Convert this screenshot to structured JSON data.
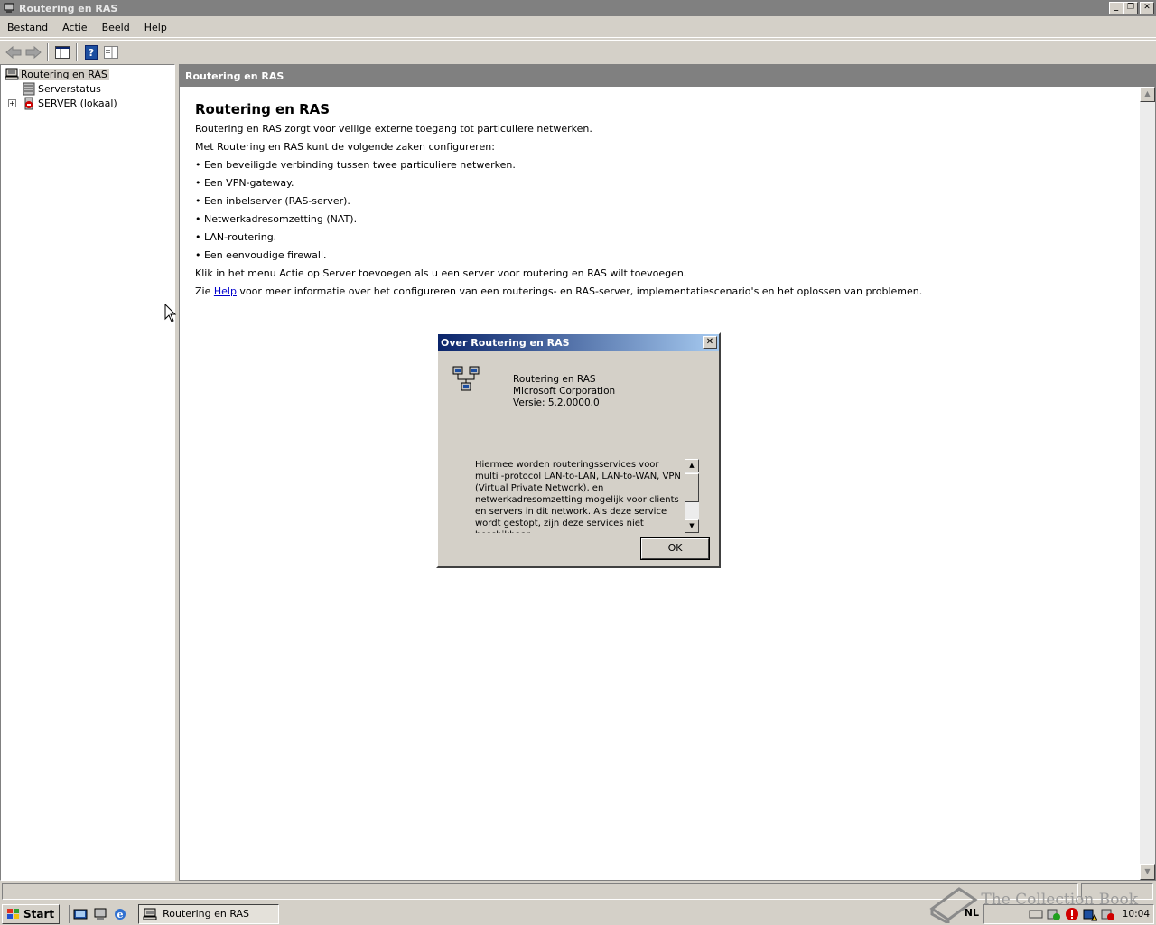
{
  "window": {
    "title": "Routering en RAS",
    "buttons": {
      "minimize": "_",
      "restore": "❐",
      "close": "✕"
    }
  },
  "menu": [
    "Bestand",
    "Actie",
    "Beeld",
    "Help"
  ],
  "tree": {
    "root": "Routering en RAS",
    "items": [
      "Serverstatus",
      "SERVER (lokaal)"
    ],
    "expander": "+"
  },
  "pane": {
    "header": "Routering en RAS",
    "heading": "Routering en RAS",
    "lines": [
      "Routering en RAS zorgt voor veilige externe toegang tot particuliere netwerken.",
      "Met Routering en RAS kunt de volgende zaken configureren:",
      "• Een beveiligde verbinding tussen twee particuliere netwerken.",
      "• Een VPN-gateway.",
      "• Een inbelserver (RAS-server).",
      "• Netwerkadresomzetting (NAT).",
      "• LAN-routering.",
      "• Een eenvoudige firewall.",
      "Klik in het menu Actie op Server toevoegen als u een server voor routering en RAS wilt toevoegen."
    ],
    "help_prefix": "Zie ",
    "help_link": "Help",
    "help_suffix": " voor meer informatie over het configureren van een routerings- en RAS-server, implementatiescenario's en het oplossen van problemen."
  },
  "dialog": {
    "title": "Over Routering en RAS",
    "product": "Routering en RAS",
    "company": "Microsoft Corporation",
    "version": "Versie: 5.2.0000.0",
    "description": "Hiermee worden routeringsservices voor multi -protocol LAN-to-LAN, LAN-to-WAN, VPN (Virtual Private Network), en netwerkadresomzetting mogelijk voor clients en servers in dit network. Als deze service wordt gestopt, zijn deze services niet beschikbaar.",
    "ok": "OK"
  },
  "taskbar": {
    "start": "Start",
    "task": "Routering en RAS",
    "language": "NL",
    "clock": "10:04"
  },
  "watermark": "The Collection Book",
  "colors": {
    "titlebar_inactive": "#808080",
    "dialog_title_start": "#0a246a",
    "dialog_title_end": "#a6caf0",
    "link": "#0000cc"
  }
}
